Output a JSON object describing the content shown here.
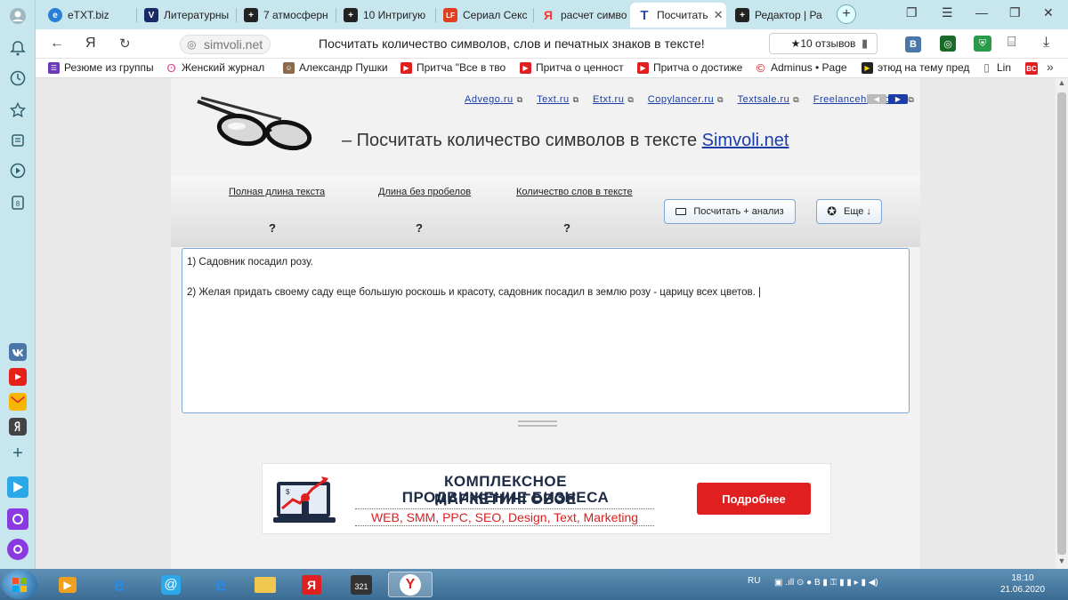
{
  "browser": {
    "tabs": [
      {
        "label": "eTXT.biz",
        "favicon_color": "#2a7fd6",
        "favicon": "e"
      },
      {
        "label": "Литературны",
        "favicon_color": "#1a2a66",
        "favicon": "V"
      },
      {
        "label": "7 атмосферн",
        "favicon_color": "#222222",
        "favicon": "+"
      },
      {
        "label": "10 Интригую",
        "favicon_color": "#222222",
        "favicon": "+"
      },
      {
        "label": "Сериал Секс",
        "favicon_color": "#e04020",
        "favicon": "LF"
      },
      {
        "label": "расчет симво",
        "favicon_color": "#ff3333",
        "favicon": "Я"
      },
      {
        "label": "Посчитать",
        "favicon_color": "#2a4aa8",
        "favicon": "T"
      },
      {
        "label": "Редактор | Ра",
        "favicon_color": "#222222",
        "favicon": "+"
      }
    ],
    "url": "simvoli.net",
    "page_title": "Посчитать количество символов, слов и печатных знаков в тексте!",
    "reviews": "★10 отзывов",
    "bookmarks": [
      {
        "label": "Резюме из группы",
        "color": "#6a3ab8"
      },
      {
        "label": "Женский журнал",
        "color": "#e0408a"
      },
      {
        "label": "Александр Пушки",
        "color": "#8a6a4a"
      },
      {
        "label": "Притча \"Все в тво",
        "color": "#e02020"
      },
      {
        "label": "Притча о ценност",
        "color": "#e02020"
      },
      {
        "label": "Притча о достиже",
        "color": "#e02020"
      },
      {
        "label": "Adminus • Page",
        "color": "#d02020"
      },
      {
        "label": "этюд на тему пред",
        "color": "#222222"
      },
      {
        "label": "Lin",
        "color": "#666666"
      }
    ]
  },
  "site": {
    "partner_links": [
      "Advego.ru",
      "Text.ru",
      "Etxt.ru",
      "Copylancer.ru",
      "Textsale.ru",
      "Freelancehunt.com"
    ],
    "heading_prefix": "– Посчитать количество символов в тексте ",
    "heading_link": "Simvoli.net",
    "stats": [
      {
        "label": "Полная длина текста",
        "value": "?"
      },
      {
        "label": "Длина без пробелов",
        "value": "?"
      },
      {
        "label": "Количество слов в тексте",
        "value": "?"
      }
    ],
    "count_button": "Посчитать + анализ",
    "more_button": "Еще ↓",
    "text_content": "1) Садовник посадил розу.\n\n2) Желая придать своему саду еще большую роскошь и красоту, садовник посадил в землю розу - царицу всех цветов. |"
  },
  "banner": {
    "line1": "КОМПЛЕКСНОЕ МАРКЕТИНГОВОЕ",
    "line2": "ПРОДВИЖЕНИЕ БИЗНЕСА",
    "line3": "WEB, SMM, PPC, SEO, Design, Text, Marketing",
    "cta": "Подробнее"
  },
  "taskbar": {
    "lang": "RU",
    "time": "18:10",
    "date": "21.06.2020"
  }
}
